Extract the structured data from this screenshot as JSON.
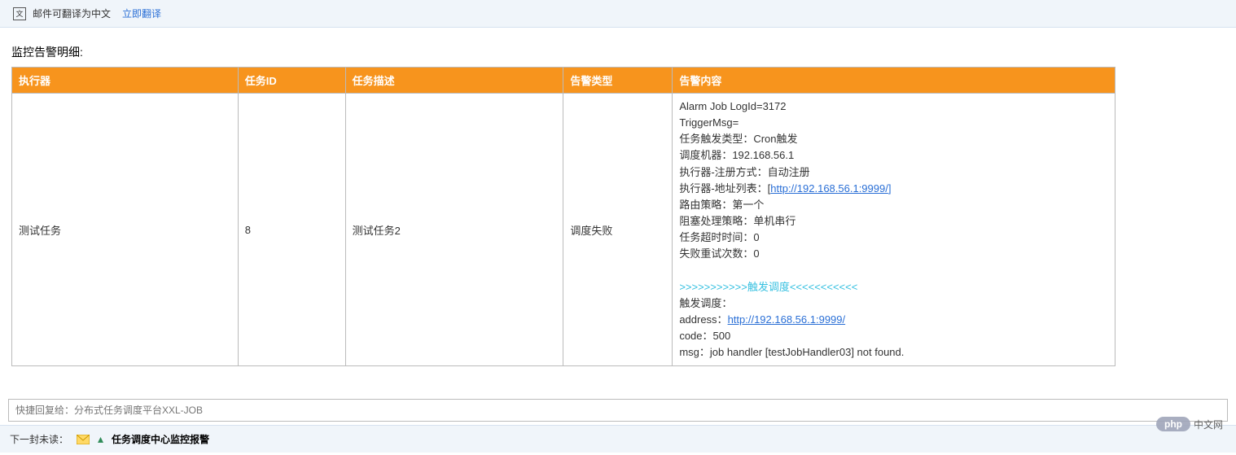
{
  "translate_bar": {
    "text": "邮件可翻译为中文",
    "link": "立即翻译"
  },
  "section_title": "监控告警明细:",
  "table": {
    "headers": {
      "executor": "执行器",
      "job_id": "任务ID",
      "job_desc": "任务描述",
      "alarm_type": "告警类型",
      "alarm_content": "告警内容"
    },
    "row": {
      "executor": "测试任务",
      "job_id": "8",
      "job_desc": "测试任务2",
      "alarm_type": "调度失败",
      "content": {
        "line1": "Alarm Job LogId=3172",
        "line2": "TriggerMsg=",
        "line3": "任务触发类型：Cron触发",
        "line4": "调度机器：192.168.56.1",
        "line5": "执行器-注册方式：自动注册",
        "line6_prefix": "执行器-地址列表：[",
        "line6_link": "http://192.168.56.1:9999/",
        "line6_suffix": "]",
        "line7": "路由策略：第一个",
        "line8": "阻塞处理策略：单机串行",
        "line9": "任务超时时间：0",
        "line10": "失败重试次数：0",
        "divider": ">>>>>>>>>>>触发调度<<<<<<<<<<<",
        "line11": "触发调度：",
        "line12_prefix": "address：",
        "line12_link": "http://192.168.56.1:9999/",
        "line13": "code：500",
        "line14": "msg：job handler [testJobHandler03] not found."
      }
    }
  },
  "reply": {
    "placeholder": "快捷回复给：分布式任务调度平台XXL-JOB"
  },
  "logo": {
    "php": "php",
    "cn": "中文网"
  },
  "next": {
    "label": "下一封未读：",
    "title": "任务调度中心监控报警"
  }
}
